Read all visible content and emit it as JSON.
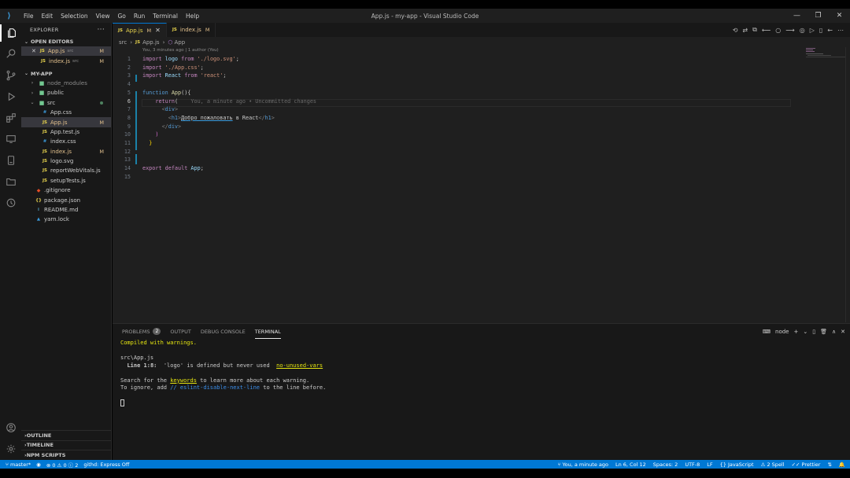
{
  "titlebar": {
    "menu": [
      "File",
      "Edit",
      "Selection",
      "View",
      "Go",
      "Run",
      "Terminal",
      "Help"
    ],
    "title": "App.js - my-app - Visual Studio Code",
    "controls": [
      "—",
      "❐",
      "✕"
    ]
  },
  "sidebar": {
    "header": "EXPLORER",
    "open_editors_title": "OPEN EDITORS",
    "open_editors": [
      {
        "icon": "JS",
        "name": "App.js",
        "path": "src",
        "badge": "M",
        "close": "✕"
      },
      {
        "icon": "JS",
        "name": "index.js",
        "path": "src",
        "badge": "M"
      }
    ],
    "project_title": "MY-APP",
    "tree": [
      {
        "name": "node_modules",
        "kind": "folder",
        "level": 1
      },
      {
        "name": "public",
        "kind": "folder",
        "level": 1
      },
      {
        "name": "src",
        "kind": "folder-open",
        "level": 1
      },
      {
        "name": "App.css",
        "icon": "#",
        "kind": "css",
        "level": 2
      },
      {
        "name": "App.js",
        "icon": "JS",
        "kind": "js",
        "level": 2,
        "badge": "M"
      },
      {
        "name": "App.test.js",
        "icon": "JS",
        "kind": "js",
        "level": 2
      },
      {
        "name": "index.css",
        "icon": "#",
        "kind": "css",
        "level": 2
      },
      {
        "name": "index.js",
        "icon": "JS",
        "kind": "js",
        "level": 2,
        "badge": "M"
      },
      {
        "name": "logo.svg",
        "icon": "JS",
        "kind": "js",
        "level": 2
      },
      {
        "name": "reportWebVitals.js",
        "icon": "JS",
        "kind": "js",
        "level": 2
      },
      {
        "name": "setupTests.js",
        "icon": "JS",
        "kind": "js",
        "level": 2
      },
      {
        "name": ".gitignore",
        "icon": "◆",
        "kind": "git",
        "level": 1
      },
      {
        "name": "package.json",
        "icon": "{}",
        "kind": "json",
        "level": 1
      },
      {
        "name": "README.md",
        "icon": "i",
        "kind": "md",
        "level": 1
      },
      {
        "name": "yarn.lock",
        "icon": "▲",
        "kind": "yarn",
        "level": 1
      }
    ],
    "bottom_sections": [
      "OUTLINE",
      "TIMELINE",
      "NPM SCRIPTS"
    ]
  },
  "tabs": [
    {
      "icon": "JS",
      "label": "App.js",
      "modified": "M",
      "close": "✕",
      "active": true
    },
    {
      "icon": "JS",
      "label": "index.js",
      "modified": "M",
      "active": false
    }
  ],
  "editor": {
    "breadcrumb": [
      "src",
      "App.js",
      "App"
    ],
    "blame_header": "You, 3 minutes ago | 1 author (You)",
    "inline_blame": "You, a minute ago • Uncommitted changes",
    "current_line": 6,
    "line_numbers": [
      "1",
      "2",
      "3",
      "4",
      "5",
      "6",
      "7",
      "8",
      "9",
      "10",
      "11",
      "12",
      "13",
      "14",
      "15"
    ]
  },
  "panel": {
    "tabs": [
      {
        "label": "PROBLEMS",
        "badge": "2"
      },
      {
        "label": "OUTPUT"
      },
      {
        "label": "DEBUG CONSOLE"
      },
      {
        "label": "TERMINAL",
        "active": true
      }
    ],
    "terminal_name": "node",
    "terminal": {
      "compiled": "Compiled with warnings.",
      "file": "src\\App.js",
      "warn_loc": "Line 1:8:",
      "warn_msg": "'logo' is defined but never used",
      "warn_rule": "no-unused-vars",
      "search_pre": "Search for the ",
      "search_kw": "keywords",
      "search_post": " to learn more about each warning.",
      "ignore_pre": "To ignore, add ",
      "ignore_code": "// eslint-disable-next-line",
      "ignore_post": " to the line before."
    }
  },
  "statusbar": {
    "branch": "master*",
    "errors": "0",
    "warnings": "0",
    "info": "2",
    "githd": "githd: Express Off",
    "blame": "You, a minute ago",
    "position": "Ln 6, Col 12",
    "spaces": "Spaces: 2",
    "encoding": "UTF-8",
    "eol": "LF",
    "language": "JavaScript",
    "spell": "2 Spell",
    "prettier": "Prettier"
  },
  "colors": {
    "accent": "#0078d4",
    "js_icon": "#e8d44d",
    "modified": "#e2c08d",
    "keyword": "#c586c0",
    "string": "#ce9178"
  }
}
